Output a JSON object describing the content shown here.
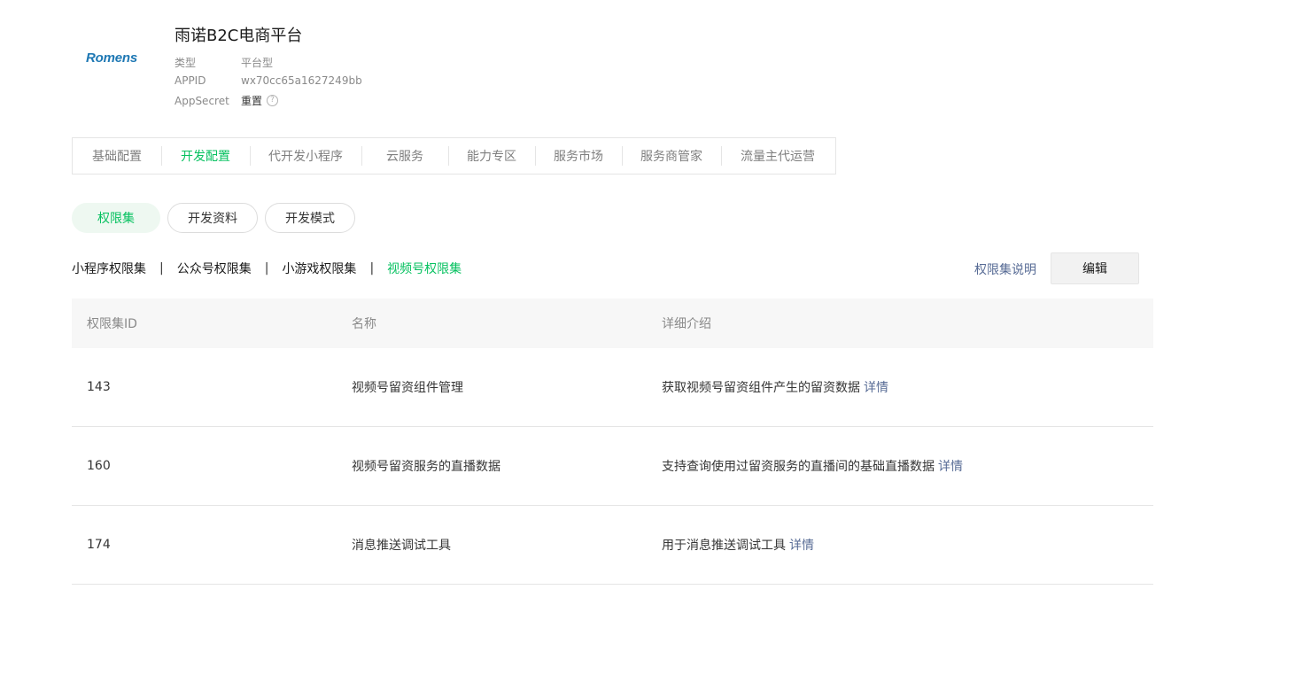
{
  "app": {
    "logo_text": "Romens",
    "title": "雨诺B2C电商平台",
    "info": [
      {
        "label": "类型",
        "value": "平台型"
      },
      {
        "label": "APPID",
        "value": "wx70cc65a1627249bb"
      },
      {
        "label": "AppSecret",
        "value": "重置"
      }
    ],
    "help_glyph": "?"
  },
  "tabs": [
    {
      "label": "基础配置",
      "active": false
    },
    {
      "label": "开发配置",
      "active": true
    },
    {
      "label": "代开发小程序",
      "active": false
    },
    {
      "label": "云服务",
      "active": false
    },
    {
      "label": "能力专区",
      "active": false
    },
    {
      "label": "服务市场",
      "active": false
    },
    {
      "label": "服务商管家",
      "active": false
    },
    {
      "label": "流量主代运营",
      "active": false
    }
  ],
  "pills": [
    {
      "label": "权限集",
      "active": true
    },
    {
      "label": "开发资料",
      "active": false
    },
    {
      "label": "开发模式",
      "active": false
    }
  ],
  "sub_tabs": [
    {
      "label": "小程序权限集",
      "active": false
    },
    {
      "label": "公众号权限集",
      "active": false
    },
    {
      "label": "小游戏权限集",
      "active": false
    },
    {
      "label": "视频号权限集",
      "active": true
    }
  ],
  "separator": "|",
  "actions": {
    "help_label": "权限集说明",
    "edit_label": "编辑"
  },
  "table": {
    "headers": [
      "权限集ID",
      "名称",
      "详细介绍"
    ],
    "rows": [
      {
        "id": "143",
        "name": "视频号留资组件管理",
        "desc": "获取视频号留资组件产生的留资数据",
        "link": "详情"
      },
      {
        "id": "160",
        "name": "视频号留资服务的直播数据",
        "desc": "支持查询使用过留资服务的直播间的基础直播数据",
        "link": "详情"
      },
      {
        "id": "174",
        "name": "消息推送调试工具",
        "desc": "用于消息推送调试工具",
        "link": "详情"
      }
    ]
  },
  "colors": {
    "accent_green": "#07c160",
    "link_blue": "#576b95",
    "logo_blue": "#1e78b4"
  }
}
